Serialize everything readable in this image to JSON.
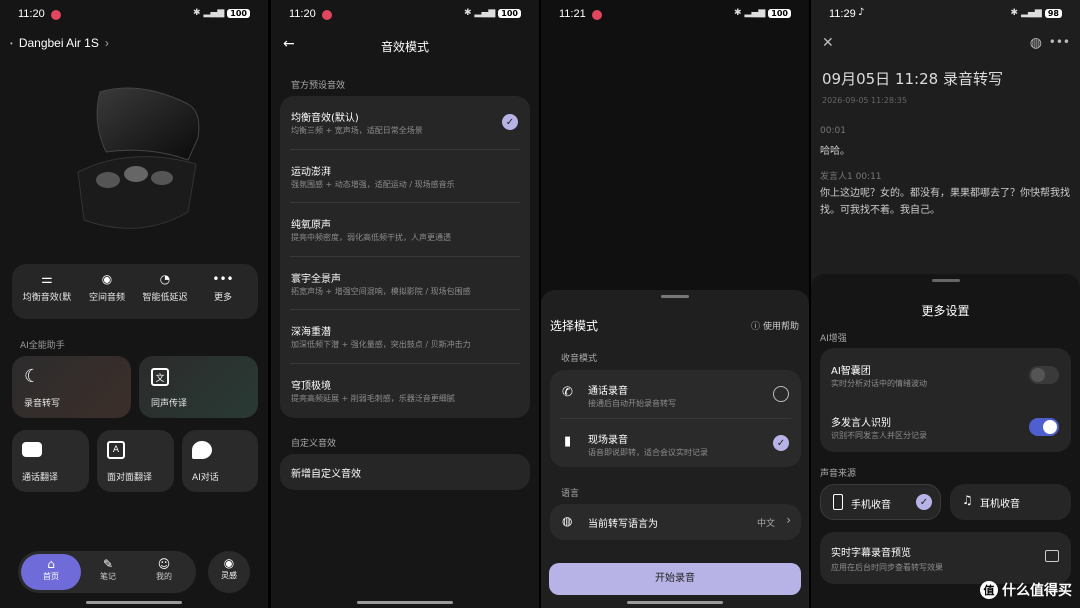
{
  "p1": {
    "time": "11:20",
    "battery": "100",
    "device_title": "Dangbei Air 1S",
    "quick": [
      "均衡音效(默",
      "空间音频",
      "智能低延迟",
      "更多"
    ],
    "section_ai": "AI全能助手",
    "tiles": [
      "录音转写",
      "同声传译",
      "通话翻译",
      "面对面翻译",
      "AI对话"
    ],
    "nav": [
      "首页",
      "笔记",
      "我的"
    ],
    "nav_extra": "灵感"
  },
  "p2": {
    "time": "11:20",
    "battery": "100",
    "title": "音效模式",
    "section_preset": "官方预设音效",
    "presets": [
      {
        "name": "均衡音效(默认)",
        "desc": "均衡三频 + 宽声场，适配日常全场景",
        "checked": true
      },
      {
        "name": "运动澎湃",
        "desc": "强氛围感 + 动态增强，适配运动 / 现场感音乐"
      },
      {
        "name": "纯氧原声",
        "desc": "提亮中频密度，弱化高低频干扰，人声更通透"
      },
      {
        "name": "寰宇全景声",
        "desc": "拓宽声场 + 增强空间混响，模拟影院 / 现场包围感"
      },
      {
        "name": "深海重潜",
        "desc": "加深低频下潜 + 强化量感，突出鼓点 / 贝斯冲击力"
      },
      {
        "name": "穹顶极境",
        "desc": "提亮高频延展 + 削弱毛刺感，乐器泛音更细腻"
      }
    ],
    "section_custom": "自定义音效",
    "add_custom": "新增自定义音效"
  },
  "p3": {
    "time": "11:21",
    "battery": "100",
    "sheet_title": "选择模式",
    "help": "使用帮助",
    "section_mode": "收音模式",
    "modes": [
      {
        "name": "通话录音",
        "desc": "接通后自动开始录音转写",
        "checked": false
      },
      {
        "name": "现场录音",
        "desc": "语音即说即转，适合会议实时记录",
        "checked": true
      }
    ],
    "section_lang": "语言",
    "lang_label": "当前转写语言为",
    "lang_value": "中文",
    "start": "开始录音"
  },
  "p4": {
    "time": "11:29",
    "battery": "98",
    "title": "09月05日 11:28 录音转写",
    "datetime": "2026-09-05 11:28:35",
    "t1_time": "00:01",
    "t1_text": "哈哈。",
    "t2_speaker": "发言人1 00:11",
    "t2_text": "你上这边呢？女的。都没有，果果都哪去了？你快帮我找找。可我找不着。我自己。",
    "sheet_title": "更多设置",
    "section_ai": "AI增强",
    "ai1_name": "AI智囊团",
    "ai1_desc": "实时分析对话中的情绪波动",
    "ai1_on": false,
    "ai2_name": "多发言人识别",
    "ai2_desc": "识别不同发言人并区分记录",
    "ai2_on": true,
    "section_source": "声音来源",
    "src1": "手机收音",
    "src2": "耳机收音",
    "live_name": "实时字幕录音预览",
    "live_desc": "应用在后台时同步查看转写效果"
  },
  "watermark": "什么值得买",
  "colors": {
    "accent": "#b8b3e6",
    "toggle_on": "#4f5fcf",
    "panel_bg": "#161616"
  }
}
